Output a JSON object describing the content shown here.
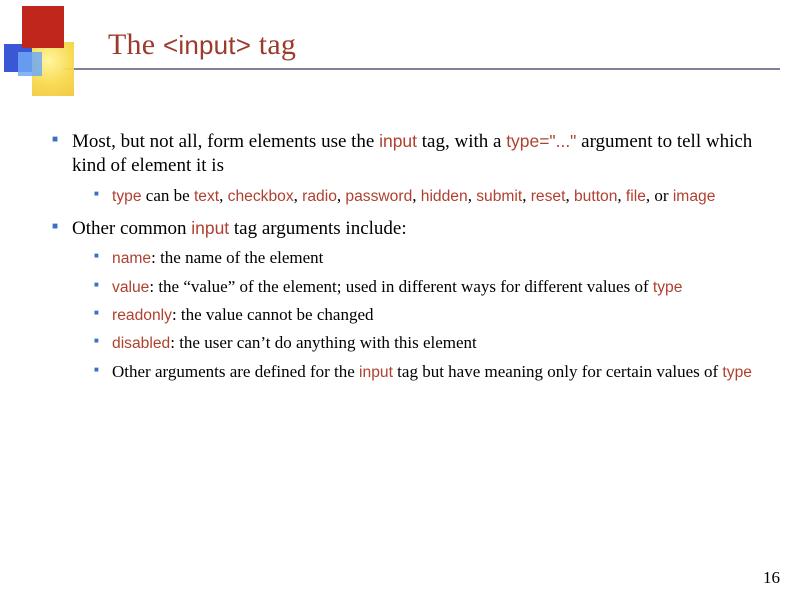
{
  "title": {
    "pre": "The ",
    "code": "<input>",
    "post": " tag"
  },
  "bullets": [
    {
      "segments": [
        {
          "t": "Most, but not all, form elements use the "
        },
        {
          "t": "input",
          "c": true
        },
        {
          "t": " tag, with a "
        },
        {
          "t": "type=\"...\"",
          "c": true
        },
        {
          "t": " argument to tell which kind of element it is"
        }
      ],
      "sub": [
        {
          "segments": [
            {
              "t": "type",
              "c": true
            },
            {
              "t": " can be "
            },
            {
              "t": "text",
              "c": true
            },
            {
              "t": ", "
            },
            {
              "t": "checkbox",
              "c": true
            },
            {
              "t": ", "
            },
            {
              "t": "radio",
              "c": true
            },
            {
              "t": ", "
            },
            {
              "t": "password",
              "c": true
            },
            {
              "t": ", "
            },
            {
              "t": "hidden",
              "c": true
            },
            {
              "t": ", "
            },
            {
              "t": "submit",
              "c": true
            },
            {
              "t": ", "
            },
            {
              "t": "reset",
              "c": true
            },
            {
              "t": ", "
            },
            {
              "t": "button",
              "c": true
            },
            {
              "t": ", "
            },
            {
              "t": "file",
              "c": true
            },
            {
              "t": ", or "
            },
            {
              "t": "image",
              "c": true
            }
          ]
        }
      ]
    },
    {
      "segments": [
        {
          "t": "Other common "
        },
        {
          "t": "input",
          "c": true
        },
        {
          "t": " tag arguments include:"
        }
      ],
      "sub": [
        {
          "segments": [
            {
              "t": "name",
              "c": true
            },
            {
              "t": ": the name of the element"
            }
          ]
        },
        {
          "segments": [
            {
              "t": "value",
              "c": true
            },
            {
              "t": ": the “value” of the element; used in different ways for different values of "
            },
            {
              "t": "type",
              "c": true
            }
          ]
        },
        {
          "segments": [
            {
              "t": "readonly",
              "c": true
            },
            {
              "t": ": the value cannot be changed"
            }
          ]
        },
        {
          "segments": [
            {
              "t": "disabled",
              "c": true
            },
            {
              "t": ": the user can’t do anything with this element"
            }
          ]
        },
        {
          "segments": [
            {
              "t": "Other arguments are defined for the "
            },
            {
              "t": "input",
              "c": true
            },
            {
              "t": " tag but have meaning only for certain values of "
            },
            {
              "t": "type",
              "c": true
            }
          ]
        }
      ]
    }
  ],
  "pageNumber": "16"
}
